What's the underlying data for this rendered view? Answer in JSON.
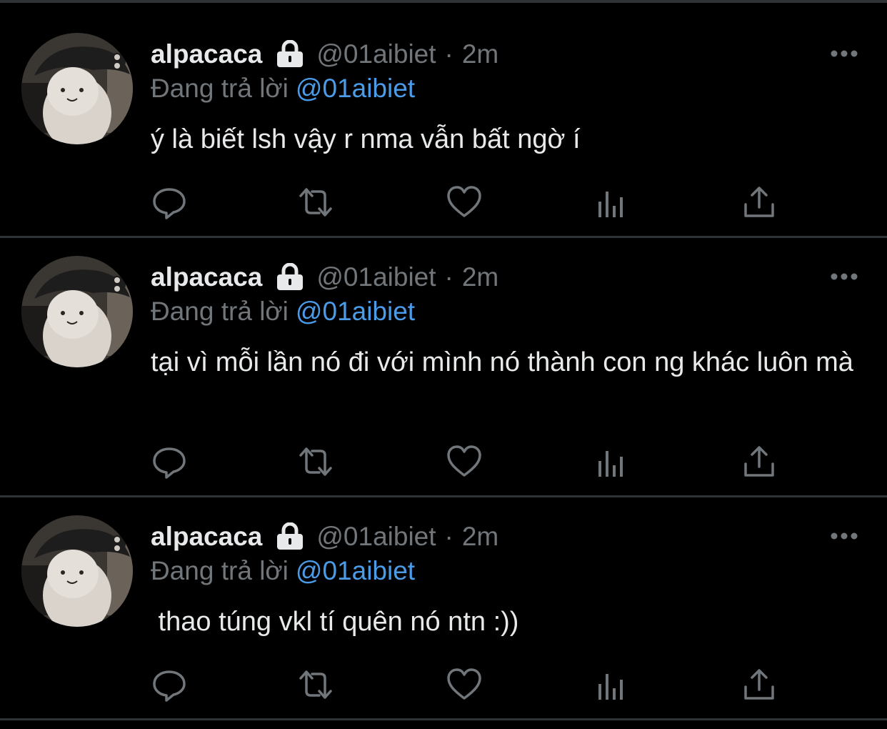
{
  "colors": {
    "background": "#000000",
    "text": "#e7e9ea",
    "muted": "#71767b",
    "link": "#4a9be8",
    "divider": "#2f3336"
  },
  "tweets": [
    {
      "name": "alpacaca",
      "handle": "@01aibiet",
      "separator": "·",
      "time": "2m",
      "reply_prefix": "Đang trả lời",
      "reply_to": "@01aibiet",
      "text": "ý là biết lsh vậy r nma vẫn bất ngờ í",
      "icons": [
        "lock-icon",
        "more-icon",
        "reply-icon",
        "retweet-icon",
        "like-icon",
        "analytics-icon",
        "share-icon"
      ]
    },
    {
      "name": "alpacaca",
      "handle": "@01aibiet",
      "separator": "·",
      "time": "2m",
      "reply_prefix": "Đang trả lời",
      "reply_to": "@01aibiet",
      "text": "tại vì mỗi lần nó đi với mình nó thành con ng khác luôn mà",
      "icons": [
        "lock-icon",
        "more-icon",
        "reply-icon",
        "retweet-icon",
        "like-icon",
        "analytics-icon",
        "share-icon"
      ]
    },
    {
      "name": "alpacaca",
      "handle": "@01aibiet",
      "separator": "·",
      "time": "2m",
      "reply_prefix": "Đang trả lời",
      "reply_to": "@01aibiet",
      "text": " thao túng vkl tí quên nó ntn :))",
      "icons": [
        "lock-icon",
        "more-icon",
        "reply-icon",
        "retweet-icon",
        "like-icon",
        "analytics-icon",
        "share-icon"
      ]
    }
  ]
}
